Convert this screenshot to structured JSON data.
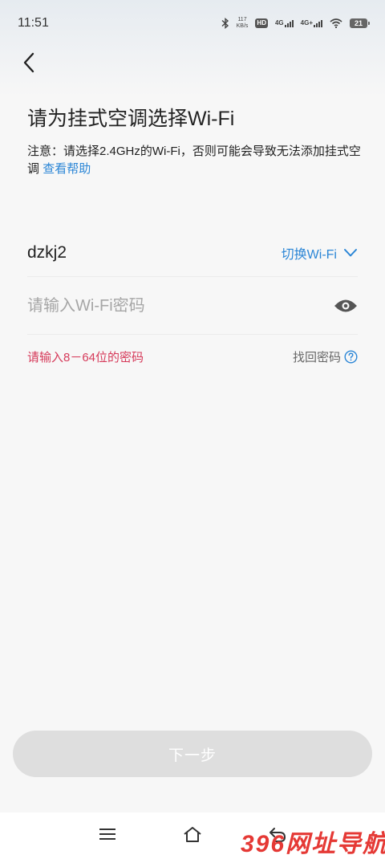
{
  "status_bar": {
    "time": "11:51",
    "net_speed_value": "117",
    "net_speed_unit": "KB/s",
    "hd_label": "HD",
    "signal1_label": "4G",
    "signal2_label": "4G+",
    "battery_level": "21"
  },
  "header": {
    "title": "请为挂式空调选择Wi-Fi",
    "notice": "注意：请选择2.4GHz的Wi-Fi，否则可能会导致无法添加挂式空调",
    "help_link": "查看帮助"
  },
  "wifi": {
    "ssid": "dzkj2",
    "switch_label": "切换Wi-Fi"
  },
  "password": {
    "placeholder": "请输入Wi-Fi密码",
    "value": ""
  },
  "hints": {
    "error": "请输入8－64位的密码",
    "find_password": "找回密码"
  },
  "next_button": "下一步",
  "watermark": "396网址导航",
  "colors": {
    "accent": "#2b86d6",
    "error": "#d63a5a",
    "button_disabled": "#dedede",
    "background": "#f7f7f7"
  },
  "icons": {
    "back": "chevron-left-icon",
    "switch": "chevron-down-icon",
    "visibility": "eye-icon",
    "help": "question-circle-icon",
    "nav_menu": "menu-icon",
    "nav_home": "home-icon",
    "nav_back": "back-icon"
  }
}
